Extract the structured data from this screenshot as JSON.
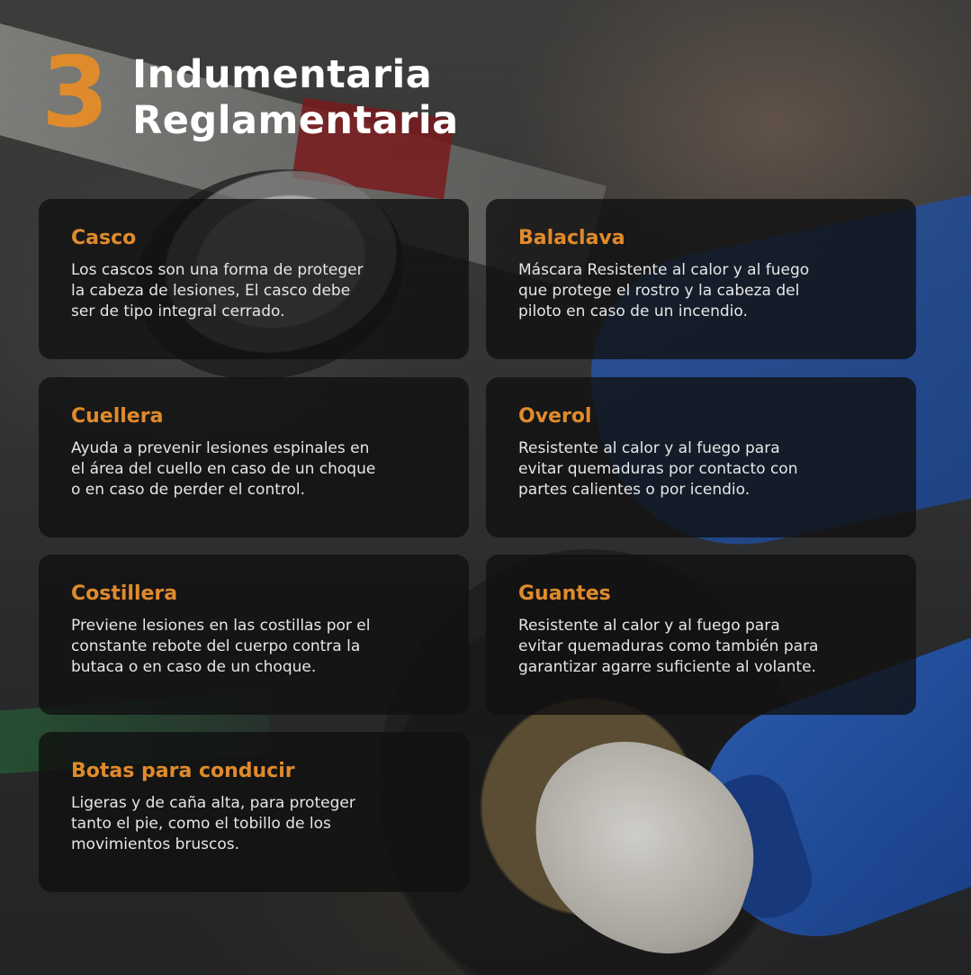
{
  "heading": {
    "number": "3",
    "title_line1": "Indumentaria",
    "title_line2": "Reglamentaria"
  },
  "colors": {
    "accent": "#e08b2b",
    "card_background": "#101010",
    "text": "#e6e6e6"
  },
  "cards": [
    {
      "title": "Casco",
      "text": "Los cascos son una forma de proteger\nla cabeza de lesiones, El casco debe\nser de tipo integral cerrado."
    },
    {
      "title": "Balaclava",
      "text": "Máscara Resistente al calor y al fuego\nque protege el rostro y la cabeza del\npiloto en caso de un incendio."
    },
    {
      "title": "Cuellera",
      "text": "Ayuda a prevenir lesiones espinales en\nel área del cuello en caso de un choque\no en caso de perder el control."
    },
    {
      "title": "Overol",
      "text": "Resistente al calor y al fuego para\nevitar quemaduras por contacto con\npartes calientes o por icendio."
    },
    {
      "title": "Costillera",
      "text": "Previene lesiones en las costillas por el\nconstante rebote del cuerpo contra la\nbutaca o en caso de un choque."
    },
    {
      "title": "Guantes",
      "text": "Resistente al calor y al fuego para\nevitar quemaduras como también para\ngarantizar agarre suficiente al volante."
    },
    {
      "title": "Botas para conducir",
      "text": "Ligeras y de caña alta, para proteger\ntanto el pie, como el tobillo de los\nmovimientos bruscos."
    }
  ]
}
